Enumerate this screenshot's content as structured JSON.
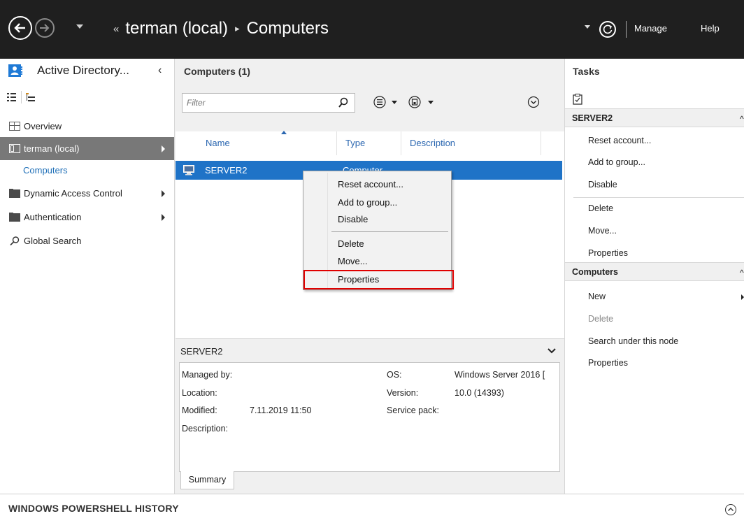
{
  "titlebar": {
    "crumb_prefix": "«",
    "crumb_root": "terman (local)",
    "crumb_sep": "▸",
    "crumb_current": "Computers",
    "manage": "Manage",
    "help": "Help"
  },
  "left": {
    "title": "Active Directory...",
    "collapse": "‹",
    "items": [
      {
        "label": "Overview"
      },
      {
        "label": "terman (local)"
      },
      {
        "label": "Computers"
      },
      {
        "label": "Dynamic Access Control"
      },
      {
        "label": "Authentication"
      },
      {
        "label": "Global Search"
      }
    ]
  },
  "center": {
    "title": "Computers",
    "count": "(1)",
    "filter_placeholder": "Filter",
    "columns": [
      "Name",
      "Type",
      "Description"
    ],
    "row": {
      "name": "SERVER2",
      "type": "Computer"
    },
    "detail_title": "SERVER2",
    "details": {
      "managed_by_label": "Managed by:",
      "location_label": "Location:",
      "modified_label": "Modified:",
      "modified_value": "7.11.2019 11:50",
      "description_label": "Description:",
      "os_label": "OS:",
      "os_value": "Windows Server 2016 [",
      "version_label": "Version:",
      "version_value": "10.0 (14393)",
      "service_pack_label": "Service pack:"
    },
    "summary_tab": "Summary"
  },
  "context_menu": {
    "items": [
      "Reset account...",
      "Add to group...",
      "Disable",
      "Delete",
      "Move...",
      "Properties"
    ],
    "highlighted": "Properties"
  },
  "right": {
    "title": "Tasks",
    "section1": "SERVER2",
    "section1_items": [
      "Reset account...",
      "Add to group...",
      "Disable",
      "Delete",
      "Move...",
      "Properties"
    ],
    "section2": "Computers",
    "section2_items": [
      "New",
      "Delete",
      "Search under this node",
      "Properties"
    ],
    "caret": "^"
  },
  "bottom": {
    "title": "WINDOWS POWERSHELL HISTORY"
  },
  "colors": {
    "titlebar": "#1f1f1f",
    "selection": "#1f73c7",
    "nav_selected": "#787878",
    "highlight_box": "#e00000"
  }
}
